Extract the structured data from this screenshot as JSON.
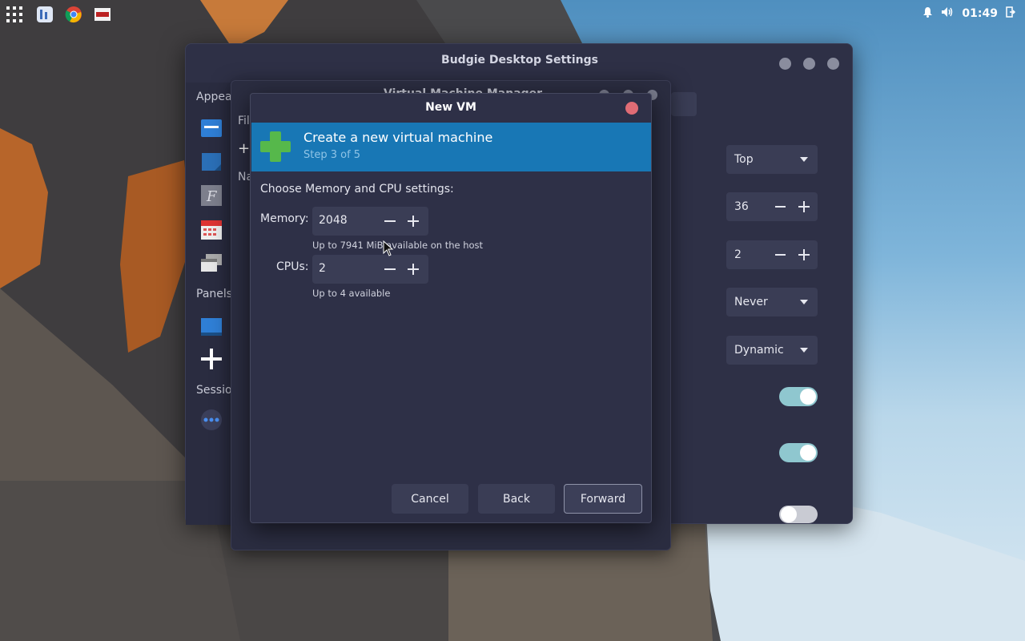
{
  "taskbar": {
    "clock": "01:49",
    "apps": [
      "apps-grid",
      "budgie-settings",
      "chrome",
      "virt-manager"
    ]
  },
  "budgie_window": {
    "title": "Budgie Desktop Settings",
    "sidebar": {
      "appearance_label": "Appear",
      "panels_label": "Panels",
      "session_label": "Sessio"
    },
    "settings": {
      "position": "Top",
      "size": "36",
      "spacing": "2",
      "autohide": "Never",
      "transparency": "Dynamic"
    },
    "toggles": [
      true,
      true,
      false
    ]
  },
  "vmm_window": {
    "title": "Virtual Machine Manager",
    "filter_stub": "Fil",
    "name_stub": "Na"
  },
  "dialog": {
    "title": "New VM",
    "banner": {
      "title": "Create a new virtual machine",
      "step": "Step 3 of 5"
    },
    "section_label": "Choose Memory and CPU settings:",
    "memory": {
      "label": "Memory:",
      "value": "2048",
      "hint": "Up to 7941 MiB available on the host"
    },
    "cpus": {
      "label": "CPUs:",
      "value": "2",
      "hint": "Up to 4 available"
    },
    "buttons": {
      "cancel": "Cancel",
      "back": "Back",
      "forward": "Forward"
    }
  },
  "colors": {
    "banner": "#1877b5",
    "toggle_on": "#8fc7cf",
    "close_button": "#e06c75"
  }
}
